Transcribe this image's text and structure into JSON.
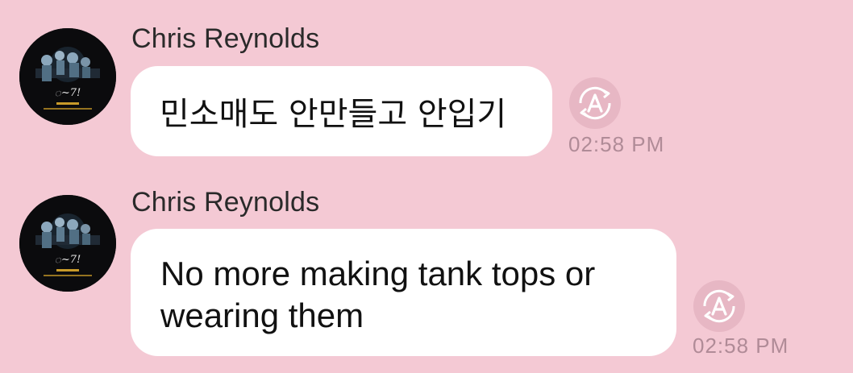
{
  "colors": {
    "background": "#f4c9d4",
    "bubble": "#ffffff",
    "sender_text": "#2a2a2a",
    "message_text": "#111111",
    "timestamp": "#b08b97",
    "icon_fill": "#e7b7c4",
    "avatar_bg": "#0b0b0d"
  },
  "messages": [
    {
      "sender": "Chris Reynolds",
      "text": "민소매도 안만들고 안입기",
      "time": "02:58 PM",
      "avatar_icon": "group-photo-avatar",
      "action_icon": "translate-icon"
    },
    {
      "sender": "Chris Reynolds",
      "text": "No more making tank tops or wearing them",
      "time": "02:58 PM",
      "avatar_icon": "group-photo-avatar",
      "action_icon": "translate-icon"
    }
  ]
}
